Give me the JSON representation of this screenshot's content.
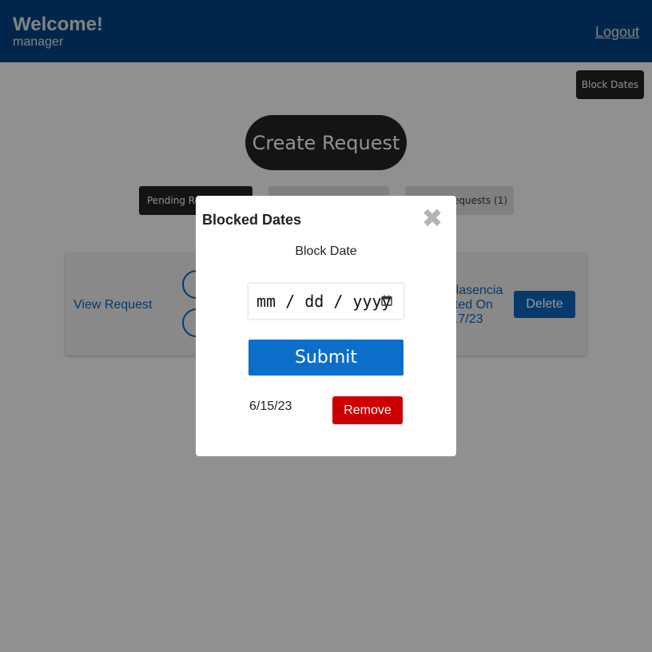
{
  "header": {
    "welcome": "Welcome!",
    "role": "manager",
    "logout_label": "Logout"
  },
  "toolbar": {
    "block_dates_label": "Block Dates",
    "create_request_label": "Create Request"
  },
  "tabs": [
    {
      "label": "Pending Re"
    },
    {
      "label": ""
    },
    {
      "label": "equests (1)"
    }
  ],
  "request_card": {
    "view_label": "View Request",
    "info_text": "Plasencia\nated On\n/17/23",
    "delete_label": "Delete"
  },
  "modal": {
    "title": "Blocked Dates",
    "close_icon": "close-icon",
    "block_date_label": "Block Date",
    "date_placeholder": "mm / dd / yyyy",
    "submit_label": "Submit",
    "blocked_dates": [
      {
        "date": "6/15/23",
        "remove_label": "Remove"
      }
    ]
  },
  "colors": {
    "header_bg": "#00427d",
    "primary": "#0b6fc9",
    "danger": "#cc0000",
    "dark_button": "#222222"
  }
}
